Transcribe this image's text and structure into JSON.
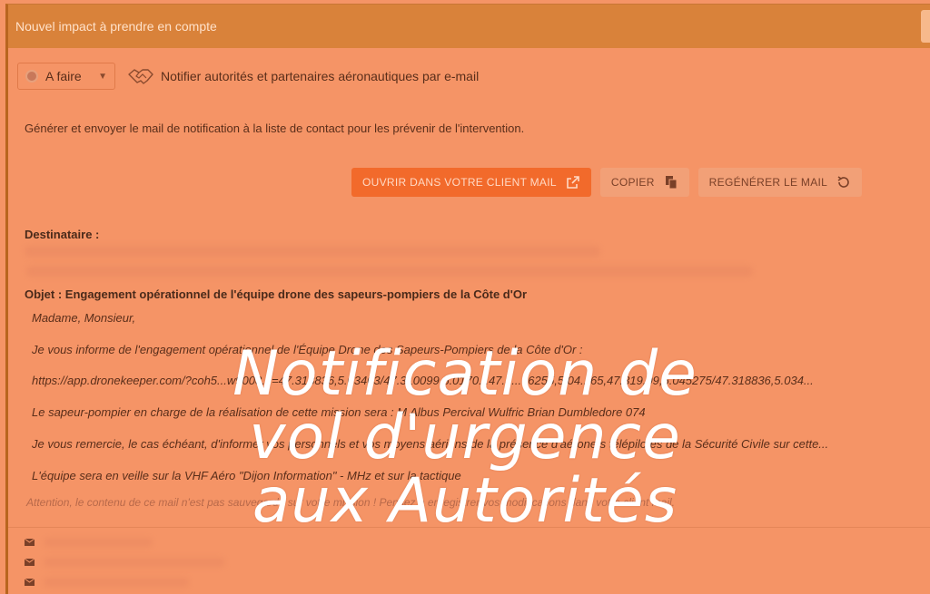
{
  "header": {
    "title": "Nouvel impact à prendre en compte"
  },
  "task": {
    "status": "A faire",
    "status_icon": "status-dot-icon",
    "type_icon": "handshake-icon",
    "title": "Notifier autorités et partenaires aéronautiques par e-mail",
    "description": "Générer et envoyer le mail de notification à la liste de contact pour les prévenir de l'intervention."
  },
  "actions": {
    "open_mail": "OUVRIR DANS VOTRE CLIENT MAIL",
    "copy": "COPIER",
    "regenerate": "REGÉNÉRER LE MAIL"
  },
  "mail": {
    "recipient_label": "Destinataire :",
    "subject": "Objet : Engagement opérationnel de l'équipe drone des sapeurs-pompiers de la Côte d'Or",
    "lines": [
      "Madame, Monsieur,",
      "Je vous informe de l'engagement opérationnel de l'Équipe Drone des Sapeurs-Pompiers de la Côte d'Or :",
      "https://app.dronekeeper.com/?coh5...w9008...=47.318836,5.03403/47.310099,5.0170...47.3...66255,5.04...65,47.319,09,5.045275/47.318836,5.034...",
      "Le sapeur-pompier en charge de la réalisation de cette mission sera : M Albus Percival Wulfric Brian Dumbledore 074",
      "Je vous remercie, le cas échéant, d'informer vos personnels et vos moyens aériens de la présence d'aéronefs télépilotés de la Sécurité Civile sur cette...",
      "L'équipe sera en veille sur la VHF Aéro \"Dijon Information\" -        MHz et sur la tactique"
    ],
    "warning": "Attention, le contenu de ce mail n'est pas sauvegardé sur votre mission ! Pensez à enregistrer vos modifications dans votre client mail."
  },
  "overlay": {
    "lines": [
      "Notification de",
      "vol d'urgence",
      "aux Autorités"
    ]
  },
  "colors": {
    "accent": "#f26a2b",
    "header": "#d9823a",
    "background": "#f59466"
  }
}
